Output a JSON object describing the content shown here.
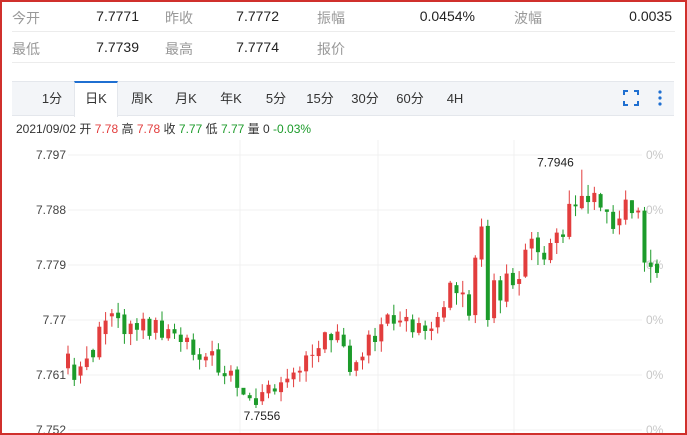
{
  "quote": {
    "open_label": "今开",
    "open_value": "7.7771",
    "prev_close_label": "昨收",
    "prev_close_value": "7.7772",
    "amplitude_label": "振幅",
    "amplitude_value": "0.0454%",
    "swing_label": "波幅",
    "swing_value": "0.0035",
    "low_label": "最低",
    "low_value": "7.7739",
    "high_label": "最高",
    "high_value": "7.7774",
    "quote_label": "报价",
    "quote_value": ""
  },
  "tabs": [
    {
      "label": "1分"
    },
    {
      "label": "日K",
      "active": true
    },
    {
      "label": "周K"
    },
    {
      "label": "月K"
    },
    {
      "label": "年K"
    },
    {
      "label": "5分"
    },
    {
      "label": "15分"
    },
    {
      "label": "30分"
    },
    {
      "label": "60分"
    },
    {
      "label": "4H"
    }
  ],
  "toolbar": {
    "fullscreen_icon": "fullscreen-icon",
    "more_icon": "more-vertical-icon"
  },
  "info": {
    "date": "2021/09/02",
    "open_label": "开",
    "open": "7.78",
    "high_label": "高",
    "high": "7.78",
    "close_label": "收",
    "close": "7.77",
    "low_label": "低",
    "low": "7.77",
    "volume_label": "量",
    "volume": "0",
    "change": "-0.03%"
  },
  "colors": {
    "up": "#e23d3d",
    "down": "#1c9b2a",
    "accent": "#1f6fd1",
    "frame": "#d0302c"
  },
  "chart_data": {
    "type": "candlestick",
    "y_ticks": [
      "7.797",
      "7.788",
      "7.779",
      "7.77",
      "7.761",
      "7.752"
    ],
    "right_ticks": [
      "0%",
      "0%",
      "0%",
      "0%",
      "0%",
      "0%"
    ],
    "ylim": [
      7.752,
      7.797
    ],
    "grid": true,
    "annotations": {
      "max_label": "7.7946",
      "min_label": "7.7556"
    },
    "candles": [
      [
        7.7621,
        7.7645,
        7.7611,
        7.7658
      ],
      [
        7.7627,
        7.7602,
        7.7592,
        7.7638
      ],
      [
        7.7609,
        7.7624,
        7.7596,
        7.7632
      ],
      [
        7.7623,
        7.7637,
        7.7618,
        7.7657
      ],
      [
        7.7651,
        7.7639,
        7.7631,
        7.7653
      ],
      [
        7.7639,
        7.7689,
        7.7635,
        7.7697
      ],
      [
        7.7677,
        7.7699,
        7.766,
        7.7713
      ],
      [
        7.7706,
        7.7711,
        7.7689,
        7.7718
      ],
      [
        7.7712,
        7.7703,
        7.7687,
        7.7728
      ],
      [
        7.7709,
        7.7677,
        7.7661,
        7.7718
      ],
      [
        7.7677,
        7.7694,
        7.7659,
        7.7699
      ],
      [
        7.7695,
        7.7684,
        7.7666,
        7.7703
      ],
      [
        7.7683,
        7.7702,
        7.7669,
        7.7712
      ],
      [
        7.7702,
        7.7674,
        7.7668,
        7.7705
      ],
      [
        7.7679,
        7.77,
        7.7668,
        7.7704
      ],
      [
        7.7699,
        7.7671,
        7.7667,
        7.7714
      ],
      [
        7.767,
        7.7685,
        7.7666,
        7.7693
      ],
      [
        7.7685,
        7.7678,
        7.7669,
        7.7694
      ],
      [
        7.7676,
        7.7664,
        7.7648,
        7.7688
      ],
      [
        7.7664,
        7.7671,
        7.7652,
        7.7676
      ],
      [
        7.7668,
        7.7643,
        7.7634,
        7.7678
      ],
      [
        7.7644,
        7.7635,
        7.7619,
        7.7654
      ],
      [
        7.7634,
        7.764,
        7.7623,
        7.7646
      ],
      [
        7.7642,
        7.7649,
        7.7625,
        7.7666
      ],
      [
        7.7652,
        7.7614,
        7.7609,
        7.7662
      ],
      [
        7.7613,
        7.7608,
        7.7595,
        7.7625
      ],
      [
        7.7609,
        7.7617,
        7.7599,
        7.7626
      ],
      [
        7.7619,
        7.7589,
        7.7575,
        7.7624
      ],
      [
        7.7589,
        7.7578,
        7.7577,
        7.7587
      ],
      [
        7.7577,
        7.7572,
        7.7568,
        7.7581
      ],
      [
        7.7572,
        7.7561,
        7.7556,
        7.7588
      ],
      [
        7.7567,
        7.7582,
        7.7561,
        7.7595
      ],
      [
        7.758,
        7.7594,
        7.7572,
        7.7601
      ],
      [
        7.7588,
        7.7583,
        7.7578,
        7.7595
      ],
      [
        7.7582,
        7.7598,
        7.7567,
        7.7607
      ],
      [
        7.7598,
        7.7604,
        7.7589,
        7.762
      ],
      [
        7.7603,
        7.7614,
        7.759,
        7.7622
      ],
      [
        7.7614,
        7.7617,
        7.7599,
        7.7624
      ],
      [
        7.7616,
        7.7642,
        7.7599,
        7.7649
      ],
      [
        7.7643,
        7.7643,
        7.7622,
        7.766
      ],
      [
        7.7641,
        7.7654,
        7.7631,
        7.7666
      ],
      [
        7.7652,
        7.768,
        7.7646,
        7.7681
      ],
      [
        7.7677,
        7.7667,
        7.7647,
        7.7679
      ],
      [
        7.7667,
        7.7681,
        7.7663,
        7.7693
      ],
      [
        7.7676,
        7.7657,
        7.7655,
        7.7687
      ],
      [
        7.7658,
        7.7615,
        7.7609,
        7.7668
      ],
      [
        7.7617,
        7.7631,
        7.7608,
        7.7634
      ],
      [
        7.7634,
        7.764,
        7.7619,
        7.7647
      ],
      [
        7.7642,
        7.7676,
        7.7629,
        7.7683
      ],
      [
        7.7674,
        7.7664,
        7.7649,
        7.7687
      ],
      [
        7.7665,
        7.7693,
        7.7648,
        7.7704
      ],
      [
        7.7694,
        7.7709,
        7.769,
        7.7711
      ],
      [
        7.7708,
        7.7694,
        7.7683,
        7.7725
      ],
      [
        7.7696,
        7.7699,
        7.7689,
        7.7714
      ],
      [
        7.7698,
        7.7705,
        7.7681,
        7.7718
      ],
      [
        7.7701,
        7.768,
        7.7671,
        7.7709
      ],
      [
        7.7679,
        7.7695,
        7.7675,
        7.7704
      ],
      [
        7.7691,
        7.7682,
        7.7668,
        7.7699
      ],
      [
        7.7682,
        7.7686,
        7.7667,
        7.7697
      ],
      [
        7.7688,
        7.7705,
        7.7678,
        7.7713
      ],
      [
        7.7704,
        7.7721,
        7.7697,
        7.7731
      ],
      [
        7.772,
        7.7761,
        7.7716,
        7.7764
      ],
      [
        7.7757,
        7.7744,
        7.7725,
        7.7762
      ],
      [
        7.7742,
        7.7745,
        7.7721,
        7.7764
      ],
      [
        7.7742,
        7.7707,
        7.7699,
        7.7749
      ],
      [
        7.7708,
        7.7802,
        7.7695,
        7.7806
      ],
      [
        7.7799,
        7.7853,
        7.7787,
        7.7866
      ],
      [
        7.7854,
        7.77,
        7.7689,
        7.7864
      ],
      [
        7.7703,
        7.7765,
        7.7695,
        7.7776
      ],
      [
        7.7765,
        7.7732,
        7.7711,
        7.7772
      ],
      [
        7.773,
        7.7776,
        7.7721,
        7.7791
      ],
      [
        7.7777,
        7.7757,
        7.7751,
        7.7785
      ],
      [
        7.7759,
        7.7767,
        7.774,
        7.778
      ],
      [
        7.7771,
        7.7815,
        7.7769,
        7.7825
      ],
      [
        7.7817,
        7.7833,
        7.7798,
        7.7844
      ],
      [
        7.7835,
        7.7811,
        7.779,
        7.7844
      ],
      [
        7.781,
        7.7799,
        7.779,
        7.7821
      ],
      [
        7.7798,
        7.7826,
        7.7793,
        7.7833
      ],
      [
        7.7826,
        7.7843,
        7.7808,
        7.785
      ],
      [
        7.784,
        7.7836,
        7.7826,
        7.7848
      ],
      [
        7.7836,
        7.789,
        7.7832,
        7.7912
      ],
      [
        7.7889,
        7.7886,
        7.787,
        7.7904
      ],
      [
        7.7883,
        7.7903,
        7.7881,
        7.7946
      ],
      [
        7.7903,
        7.7893,
        7.7874,
        7.7921
      ],
      [
        7.7893,
        7.7908,
        7.788,
        7.7918
      ],
      [
        7.7906,
        7.7884,
        7.7878,
        7.7908
      ],
      [
        7.7881,
        7.7877,
        7.7858,
        7.7881
      ],
      [
        7.7877,
        7.7849,
        7.7841,
        7.7888
      ],
      [
        7.7855,
        7.7866,
        7.784,
        7.7879
      ],
      [
        7.7864,
        7.7897,
        7.7856,
        7.7912
      ],
      [
        7.7896,
        7.7875,
        7.7866,
        7.7896
      ],
      [
        7.7876,
        7.7879,
        7.7866,
        7.7884
      ],
      [
        7.7879,
        7.7794,
        7.7779,
        7.7885
      ],
      [
        7.7794,
        7.7787,
        7.7761,
        7.7815
      ],
      [
        7.7792,
        7.7777,
        7.7769,
        7.7799
      ]
    ]
  }
}
